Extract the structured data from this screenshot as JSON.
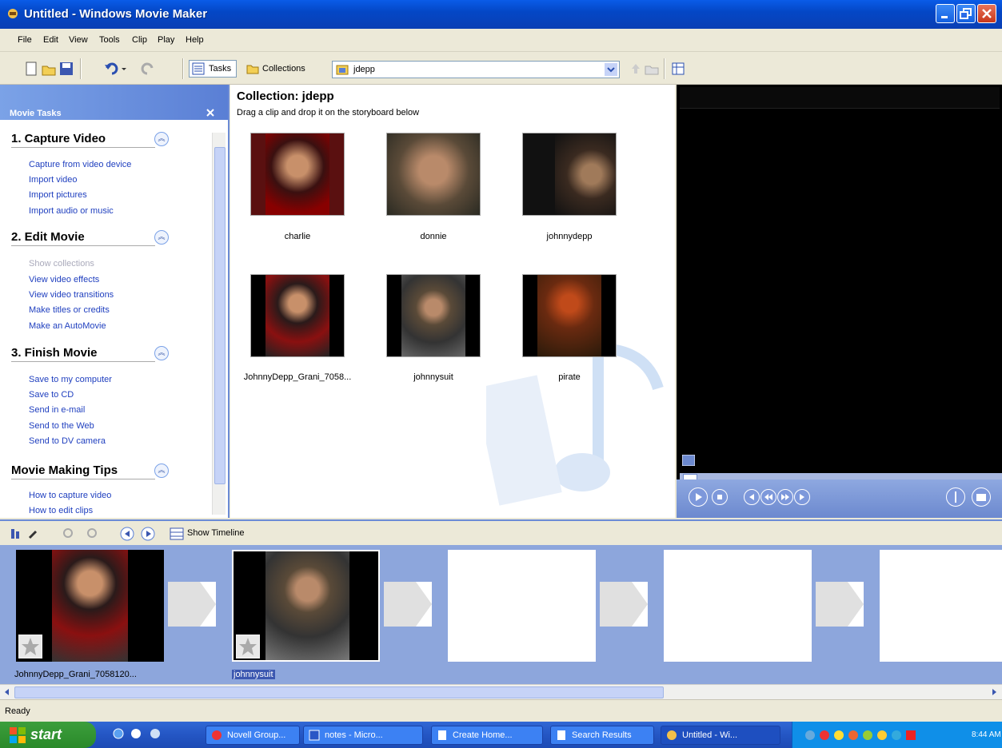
{
  "window": {
    "title": "Untitled - Windows Movie Maker"
  },
  "menu": [
    "File",
    "Edit",
    "View",
    "Tools",
    "Clip",
    "Play",
    "Help"
  ],
  "toolbar": {
    "tasks_label": "Tasks",
    "collections_label": "Collections",
    "collection_value": "jdepp"
  },
  "tasks": {
    "header": "Movie Tasks",
    "sections": [
      {
        "title": "1. Capture Video",
        "links": [
          "Capture from video device",
          "Import video",
          "Import pictures",
          "Import audio or music"
        ]
      },
      {
        "title": "2. Edit Movie",
        "links": [
          "Show collections",
          "View video effects",
          "View video transitions",
          "Make titles or credits",
          "Make an AutoMovie"
        ]
      },
      {
        "title": "3. Finish Movie",
        "links": [
          "Save to my computer",
          "Save to CD",
          "Send in e-mail",
          "Send to the Web",
          "Send to DV camera"
        ]
      },
      {
        "title": "Movie Making Tips",
        "links": [
          "How to capture video",
          "How to edit clips"
        ]
      }
    ]
  },
  "collection": {
    "title": "Collection: jdepp",
    "subtitle": "Drag a clip and drop it on the storyboard below",
    "clips": [
      "charlie",
      "donnie",
      "johnnydepp",
      "JohnnyDepp_Grani_7058...",
      "johnnysuit",
      "pirate"
    ]
  },
  "storyboard": {
    "toolbar_label": "Show Timeline",
    "items": [
      "JohnnyDepp_Grani_7058120...",
      "johnnysuit"
    ]
  },
  "status": {
    "text": "Ready"
  },
  "taskbar": {
    "start_label": "start",
    "buttons": [
      "Novell Group...",
      "notes - Micro...",
      "Create Home...",
      "Search Results",
      "Untitled - Wi..."
    ],
    "clock": "8:44 AM"
  }
}
